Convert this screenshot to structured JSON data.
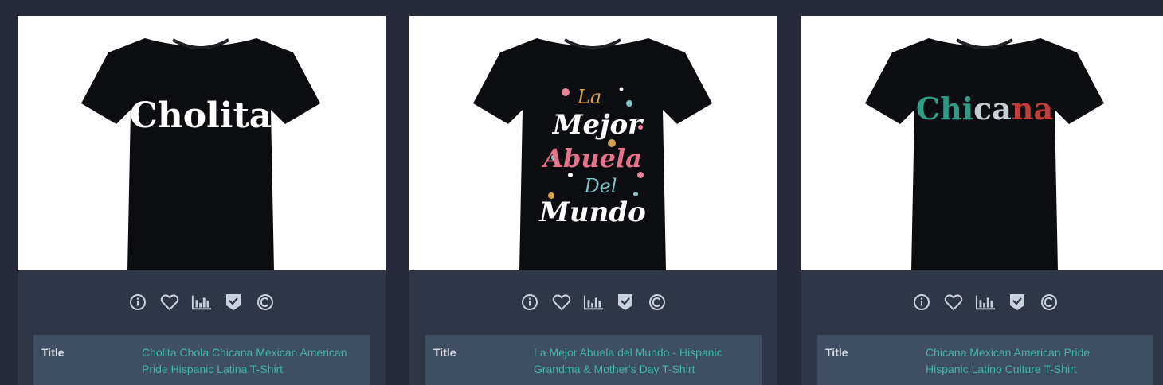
{
  "colors": {
    "page_bg": "#262a38",
    "card_bg": "#2f3747",
    "details_bg": "#404e61",
    "accent_teal": "#38b9a2",
    "icon_color": "#c9d1da"
  },
  "icons": [
    "info-icon",
    "heart-icon",
    "bar-chart-icon",
    "shield-check-icon",
    "copyright-icon"
  ],
  "products": [
    {
      "shirt_text": "Cholita",
      "title_label": "Title",
      "title": "Cholita Chola Chicana Mexican American Pride Hispanic Latina T-Shirt"
    },
    {
      "shirt_lines": [
        "La",
        "Mejor",
        "Abuela",
        "Del",
        "Mundo"
      ],
      "title_label": "Title",
      "title": "La Mejor Abuela del Mundo - Hispanic Grandma & Mother's Day T-Shirt"
    },
    {
      "shirt_parts": [
        "Chi",
        "ca",
        "na"
      ],
      "title_label": "Title",
      "title": "Chicana Mexican American Pride Hispanic Latino Culture T-Shirt"
    }
  ]
}
